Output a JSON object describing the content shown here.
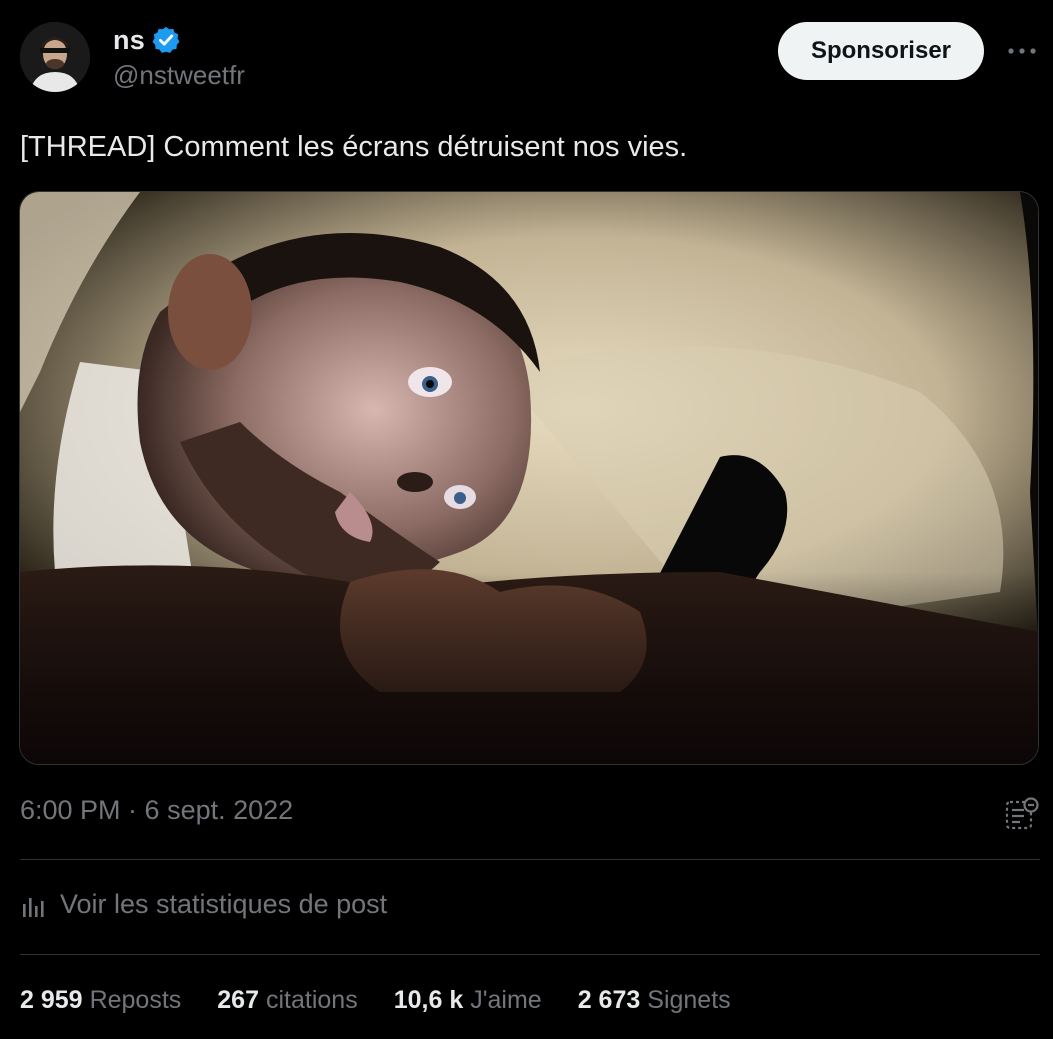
{
  "author": {
    "display_name": "ns",
    "handle": "@nstweetfr",
    "verified": true,
    "verified_color": "#1d9bf0"
  },
  "actions": {
    "sponsor_label": "Sponsoriser",
    "more_icon": "more-horizontal-icon"
  },
  "post": {
    "text": "[THREAD] Comment les écrans détruisent nos vies.",
    "media_description_icon": "photo",
    "timestamp": "6:00 PM · 6 sept. 2022"
  },
  "analytics": {
    "label": "Voir les statistiques de post",
    "icon": "bar-chart-icon"
  },
  "metrics": [
    {
      "value": "2 959",
      "label": "Reposts"
    },
    {
      "value": "267",
      "label": "citations"
    },
    {
      "value": "10,6 k",
      "label": "J'aime"
    },
    {
      "value": "2 673",
      "label": "Signets"
    }
  ],
  "colors": {
    "background": "#000000",
    "text_primary": "#e7e9ea",
    "text_secondary": "#71767b",
    "divider": "#2f3336"
  }
}
